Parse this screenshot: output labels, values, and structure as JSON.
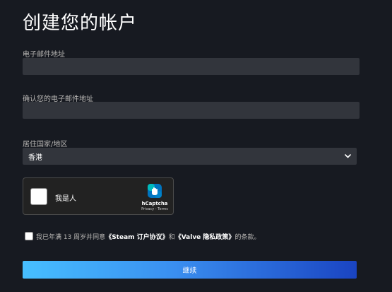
{
  "page": {
    "title": "创建您的帐户"
  },
  "email": {
    "label": "电子邮件地址",
    "value": ""
  },
  "confirm_email": {
    "label": "确认您的电子邮件地址",
    "value": ""
  },
  "country": {
    "label": "居住国家/地区",
    "selected": "香港",
    "icon": "chevron-down-icon"
  },
  "captcha": {
    "label": "我是人",
    "brand": "hCaptcha",
    "links": "Privacy - Terms",
    "icon": "hcaptcha-logo-icon"
  },
  "agreement": {
    "prefix": "我已年满 13 周岁并同意",
    "link_subscriber": "《Steam 订户协议》",
    "middle": "和",
    "link_privacy": "《Valve 隐私政策》",
    "suffix": "的条款。"
  },
  "actions": {
    "continue_label": "继续"
  },
  "colors": {
    "background": "#171a21",
    "input_bg": "#32353c",
    "button_gradient_start": "#47bfff",
    "button_gradient_end": "#1a44c2",
    "label_text": "#b8b6b4"
  }
}
